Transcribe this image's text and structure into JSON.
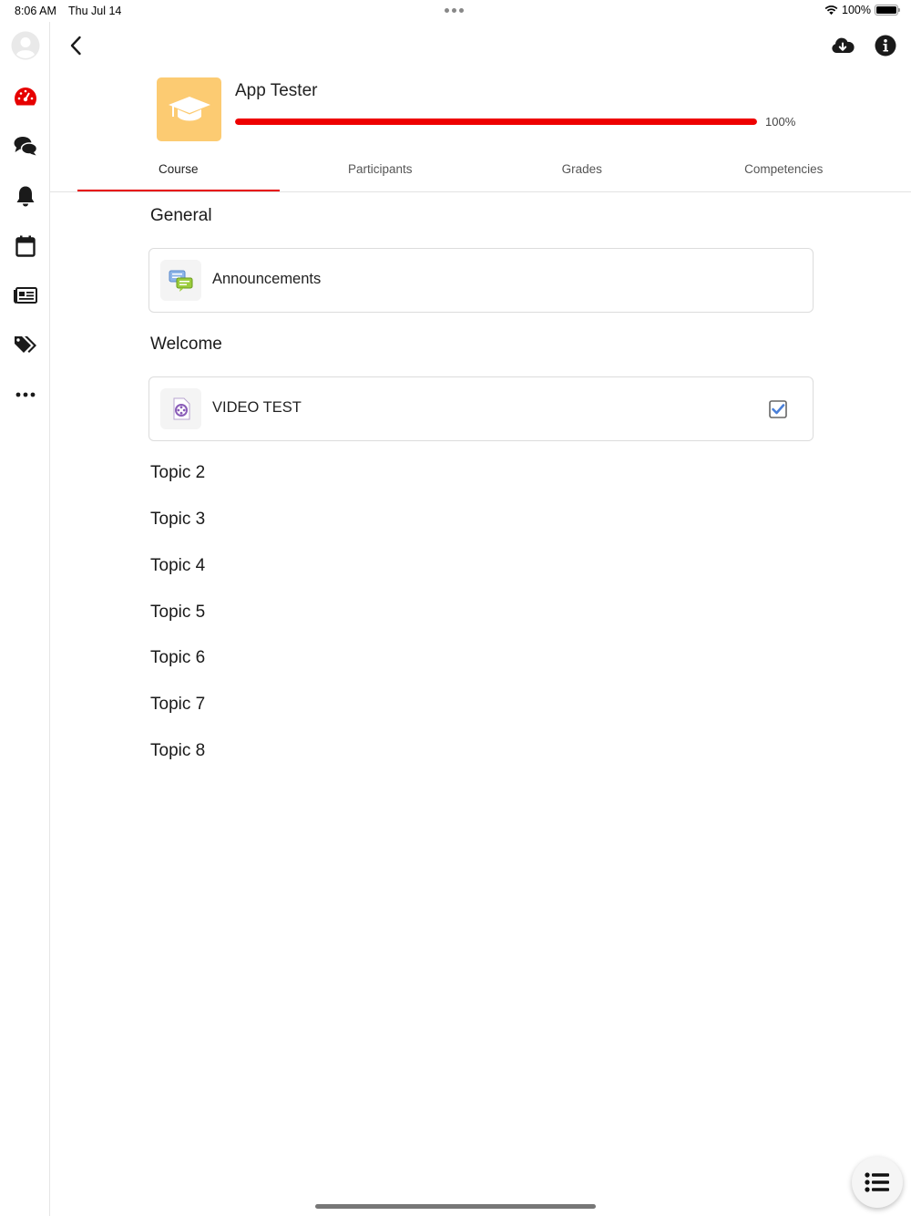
{
  "status_bar": {
    "time": "8:06 AM",
    "date": "Thu Jul 14",
    "battery": "100%",
    "battery_level": 1.0
  },
  "sidebar": {
    "items": [
      {
        "icon": "user-avatar-icon"
      },
      {
        "icon": "dashboard-gauge-icon",
        "active": true
      },
      {
        "icon": "messages-icon"
      },
      {
        "icon": "bell-icon"
      },
      {
        "icon": "calendar-icon"
      },
      {
        "icon": "news-icon"
      },
      {
        "icon": "tags-icon"
      },
      {
        "icon": "more-icon"
      }
    ]
  },
  "toolbar": {
    "back_icon": "chevron-left-icon",
    "download_icon": "cloud-download-icon",
    "info_icon": "info-icon"
  },
  "course": {
    "title": "App Tester",
    "progress_text": "100%",
    "progress_value": 100,
    "image_icon": "graduation-cap-icon"
  },
  "tabs": [
    {
      "label": "Course",
      "active": true
    },
    {
      "label": "Participants",
      "active": false
    },
    {
      "label": "Grades",
      "active": false
    },
    {
      "label": "Competencies",
      "active": false
    }
  ],
  "sections": [
    {
      "title": "General",
      "modules": [
        {
          "name": "Announcements",
          "icon": "forum-icon",
          "completed": false
        }
      ]
    },
    {
      "title": "Welcome",
      "modules": [
        {
          "name": "VIDEO TEST",
          "icon": "video-icon",
          "completed": true
        }
      ]
    },
    {
      "title": "Topic 2"
    },
    {
      "title": "Topic 3"
    },
    {
      "title": "Topic 4"
    },
    {
      "title": "Topic 5"
    },
    {
      "title": "Topic 6"
    },
    {
      "title": "Topic 7"
    },
    {
      "title": "Topic 8"
    }
  ],
  "fab": {
    "icon": "course-index-list-icon"
  },
  "colors": {
    "accent": "#e60000",
    "course_image_bg": "#fccb72",
    "check": "#4a7fd8"
  }
}
